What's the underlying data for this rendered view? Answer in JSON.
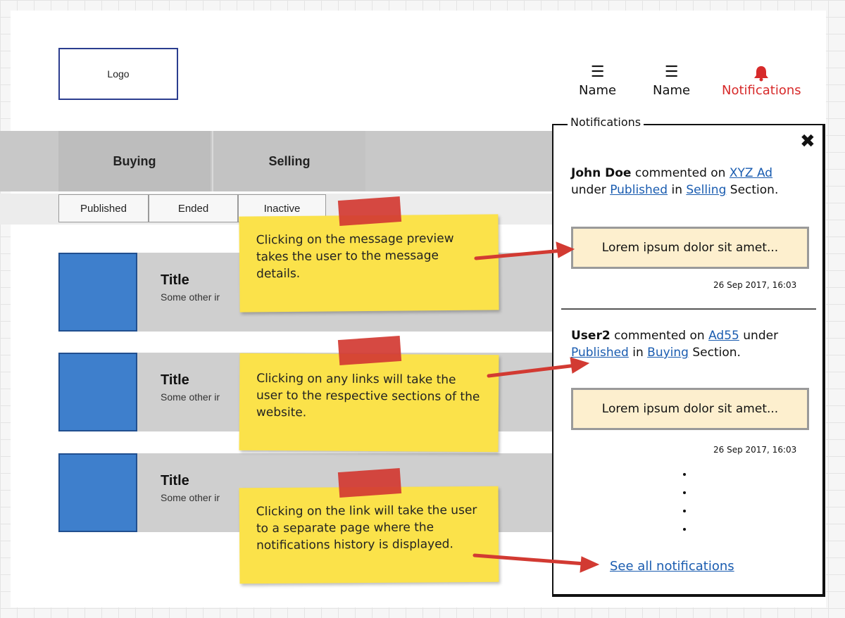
{
  "header": {
    "logo": "Logo",
    "nav": [
      {
        "icon": "list-icon",
        "label": "Name"
      },
      {
        "icon": "list-icon",
        "label": "Name"
      },
      {
        "icon": "bell-icon",
        "label": "Notifications",
        "color": "#d72a2a"
      }
    ]
  },
  "tabs": {
    "main": [
      "Buying",
      "Selling"
    ],
    "sub": [
      "Published",
      "Ended",
      "Inactive"
    ]
  },
  "listings": [
    {
      "title": "Title",
      "subtitle": "Some other ir"
    },
    {
      "title": "Title",
      "subtitle": "Some other ir"
    },
    {
      "title": "Title",
      "subtitle": "Some other ir"
    }
  ],
  "notes": [
    "Clicking on the message preview takes the user to the message details.",
    "Clicking on any links will take the user to the respective sections of the website.",
    "Clicking on the link will take the user to a separate page where the notifications history is displayed."
  ],
  "panel": {
    "legend": "Notifications",
    "close": "✖",
    "items": [
      {
        "user": "John Doe",
        "commented_on": "commented on",
        "ad": "XYZ Ad",
        "under": "under",
        "tab": "Published",
        "in": "in",
        "section": "Selling",
        "suffix": "Section.",
        "preview": "Lorem ipsum dolor sit amet...",
        "time": "26 Sep 2017, 16:03"
      },
      {
        "user": "User2",
        "commented_on": "commented on",
        "ad": "Ad55",
        "under": "under",
        "tab": "Published",
        "in": "in",
        "section": "Buying",
        "suffix": "Section.",
        "preview": "Lorem ipsum dolor sit amet...",
        "time": "26 Sep 2017, 16:03"
      }
    ],
    "see_all": "See all notifications"
  },
  "colors": {
    "accent_red": "#d72a2a",
    "link": "#1a5cb0",
    "thumb_blue": "#3e7fcc",
    "sticky_yellow": "#fbe24a"
  }
}
